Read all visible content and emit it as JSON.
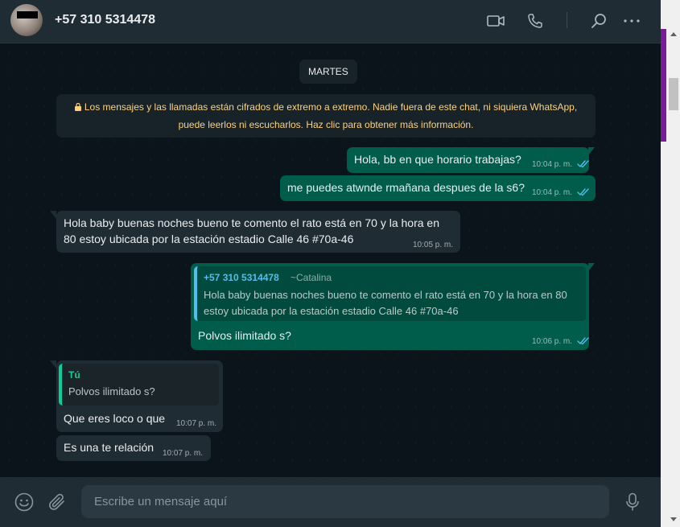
{
  "header": {
    "contact_name": "+57 310 5314478",
    "icons": [
      "video-icon",
      "phone-icon",
      "search-icon",
      "more-icon"
    ]
  },
  "chat": {
    "day_label": "MARTES",
    "system_notice_line1": "Los mensajes y las llamadas están cifrados de extremo a extremo. Nadie fuera de este chat, ni siquiera WhatsApp,",
    "system_notice_line2": "puede leerlos ni escucharlos. Haz clic para obtener más información.",
    "messages": [
      {
        "text": "Hola, bb en que horario trabajas?",
        "time": "10:04 p. m."
      },
      {
        "text": "me puedes atwnde rmañana despues de la s6?",
        "time": "10:04 p. m."
      },
      {
        "line1": "Hola baby buenas noches bueno te comento el rato está en 70 y la hora en",
        "line2": "80 estoy ubicada por la estación estadio Calle 46 #70a-46",
        "time": "10:05 p. m."
      },
      {
        "quote_author": "+57 310 5314478",
        "quote_name": "~Catalina",
        "quote_line1": "Hola baby buenas noches bueno te comento el rato está en 70 y la hora en 80",
        "quote_line2": "estoy ubicada por la estación estadio Calle 46 #70a-46",
        "text": "Polvos ilimitado s?",
        "time": "10:06 p. m."
      },
      {
        "quote_author": "Tú",
        "quote_text": "Polvos ilimitado s?",
        "text": "Que eres loco o que",
        "time": "10:07 p. m."
      },
      {
        "text": "Es una te relación",
        "time": "10:07 p. m."
      }
    ]
  },
  "footer": {
    "placeholder": "Escribe un mensaje aquí",
    "icons": [
      "emoji-icon",
      "attach-icon",
      "mic-icon"
    ]
  },
  "colors": {
    "outgoing_bubble": "#005c4b",
    "incoming_bubble": "#202c33",
    "read_tick": "#53bdeb",
    "notice_text": "#ffd279"
  }
}
